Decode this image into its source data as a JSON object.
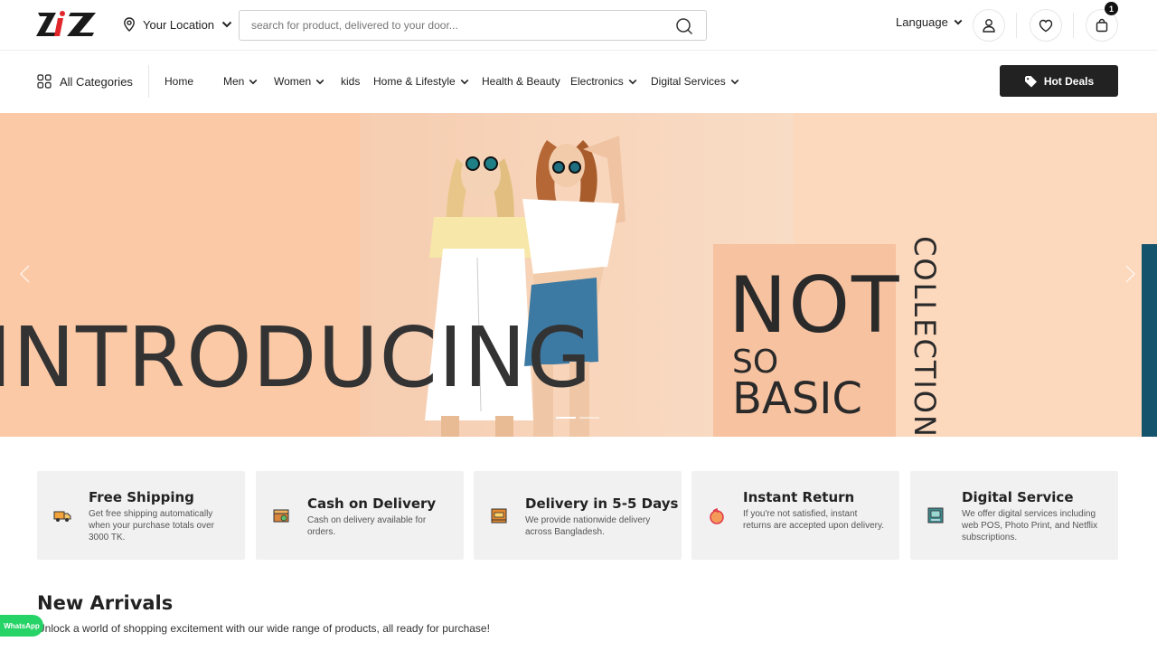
{
  "header": {
    "logo_text": "ZiZ",
    "location_label": "Your Location",
    "search_placeholder": "search for product, delivered to your door...",
    "language_label": "Language",
    "cart_count": "1"
  },
  "nav": {
    "all_categories": "All Categories",
    "items": [
      {
        "label": "Home",
        "dropdown": false
      },
      {
        "label": "Men",
        "dropdown": true
      },
      {
        "label": "Women",
        "dropdown": true
      },
      {
        "label": "kids",
        "dropdown": false
      },
      {
        "label": "Home & Lifestyle",
        "dropdown": true
      },
      {
        "label": "Health & Beauty",
        "dropdown": false
      },
      {
        "label": "Electronics",
        "dropdown": true
      },
      {
        "label": "Digital Services",
        "dropdown": true
      }
    ],
    "hot_deals": "Hot Deals"
  },
  "banner": {
    "headline": "INTRODUCING",
    "promo_line1": "NOT",
    "promo_line2": "SO",
    "promo_line3": "BASIC",
    "promo_vertical": "COLLECTION",
    "slide_count": 2,
    "active_slide": 0
  },
  "features": [
    {
      "title": "Free Shipping",
      "desc": "Get free shipping automatically when your purchase totals over 3000 TK.",
      "icon": "truck-icon"
    },
    {
      "title": "Cash on Delivery",
      "desc": "Cash on delivery available for orders.",
      "icon": "cash-box-icon"
    },
    {
      "title": "Delivery in 5-5 Days",
      "desc": "We provide nationwide delivery across Bangladesh.",
      "icon": "cod-box-icon"
    },
    {
      "title": "Instant Return",
      "desc": "If you're not satisfied, instant returns are accepted upon delivery.",
      "icon": "return-icon"
    },
    {
      "title": "Digital Service",
      "desc": "We offer digital services including web POS, Photo Print, and Netflix subscriptions.",
      "icon": "digital-service-icon"
    }
  ],
  "new_arrivals": {
    "title": "New Arrivals",
    "subtitle": "Unlock a world of shopping excitement with our wide range of products, all ready for purchase!"
  },
  "whatsapp_label": "WhatsApp",
  "colors": {
    "banner_peach": "#f8c8a6",
    "dark_button": "#222222",
    "whatsapp_green": "#25d366",
    "feature_bg": "#f1f1f1"
  }
}
